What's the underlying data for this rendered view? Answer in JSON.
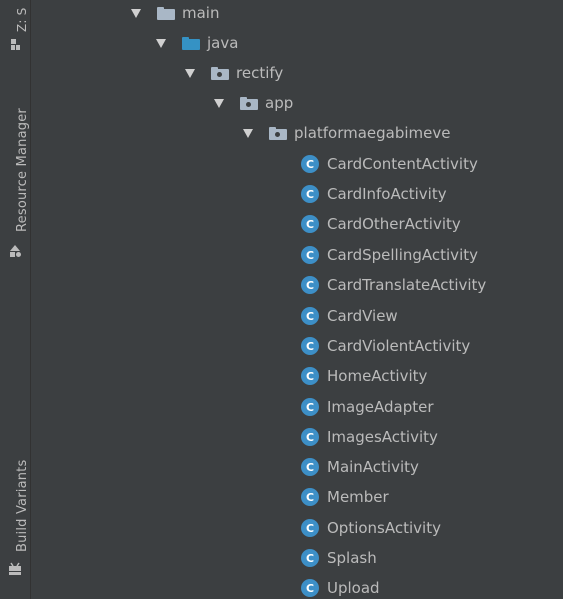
{
  "side_strip": {
    "top_label": "Z: S",
    "resource_manager_label": "Resource Manager",
    "build_variants_label": "Build Variants"
  },
  "tree": {
    "folders": [
      {
        "label": "main",
        "icon": "folder-icon",
        "color": "#a9b7c6"
      },
      {
        "label": "java",
        "icon": "source-folder-icon",
        "color": "#3592c4"
      },
      {
        "label": "rectify",
        "icon": "package-icon",
        "color": "#a9b7c6"
      },
      {
        "label": "app",
        "icon": "package-icon",
        "color": "#a9b7c6"
      },
      {
        "label": "platformaegabimeve",
        "icon": "package-icon",
        "color": "#a9b7c6"
      }
    ],
    "class_badge": "C",
    "class_icon_color": "#3d8fc7",
    "classes": [
      "CardContentActivity",
      "CardInfoActivity",
      "CardOtherActivity",
      "CardSpellingActivity",
      "CardTranslateActivity",
      "CardView",
      "CardViolentActivity",
      "HomeActivity",
      "ImageAdapter",
      "ImagesActivity",
      "MainActivity",
      "Member",
      "OptionsActivity",
      "Splash",
      "Upload"
    ]
  }
}
